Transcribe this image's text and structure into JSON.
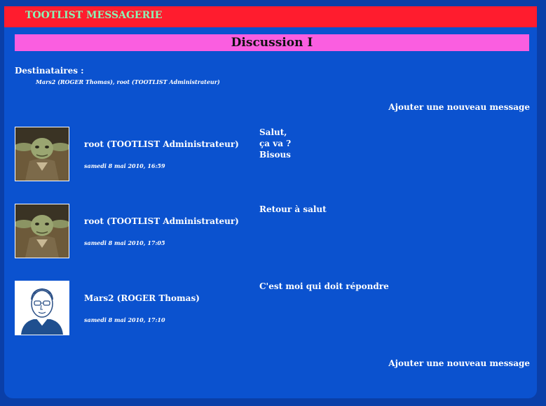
{
  "header": {
    "app_title": "TOOTLIST MESSAGERIE"
  },
  "discussion": {
    "title": "Discussion I"
  },
  "recipients": {
    "label": "Destinataires :",
    "list": "Mars2 (ROGER Thomas), root (TOOTLIST Administrateur)"
  },
  "actions": {
    "add_message_top": "Ajouter une nouveau message",
    "add_message_bottom": "Ajouter une nouveau message"
  },
  "messages": [
    {
      "author": "root (TOOTLIST Administrateur)",
      "date": "samedi 8 mai 2010, 16:59",
      "text_lines": [
        "Salut,",
        "ça va ?",
        "Bisous"
      ],
      "avatar": "yoda-avatar"
    },
    {
      "author": "root (TOOTLIST Administrateur)",
      "date": "samedi 8 mai 2010, 17:05",
      "text_lines": [
        "Retour à salut"
      ],
      "avatar": "yoda-avatar"
    },
    {
      "author": "Mars2 (ROGER Thomas)",
      "date": "samedi 8 mai 2010, 17:10",
      "text_lines": [
        "C'est moi qui doit répondre"
      ],
      "avatar": "sketch-portrait-avatar"
    }
  ],
  "colors": {
    "background": "#0b52cf",
    "header_bar": "#ff1c2e",
    "header_text": "#8cf2b4",
    "discussion_bar": "#fa5ee0"
  }
}
